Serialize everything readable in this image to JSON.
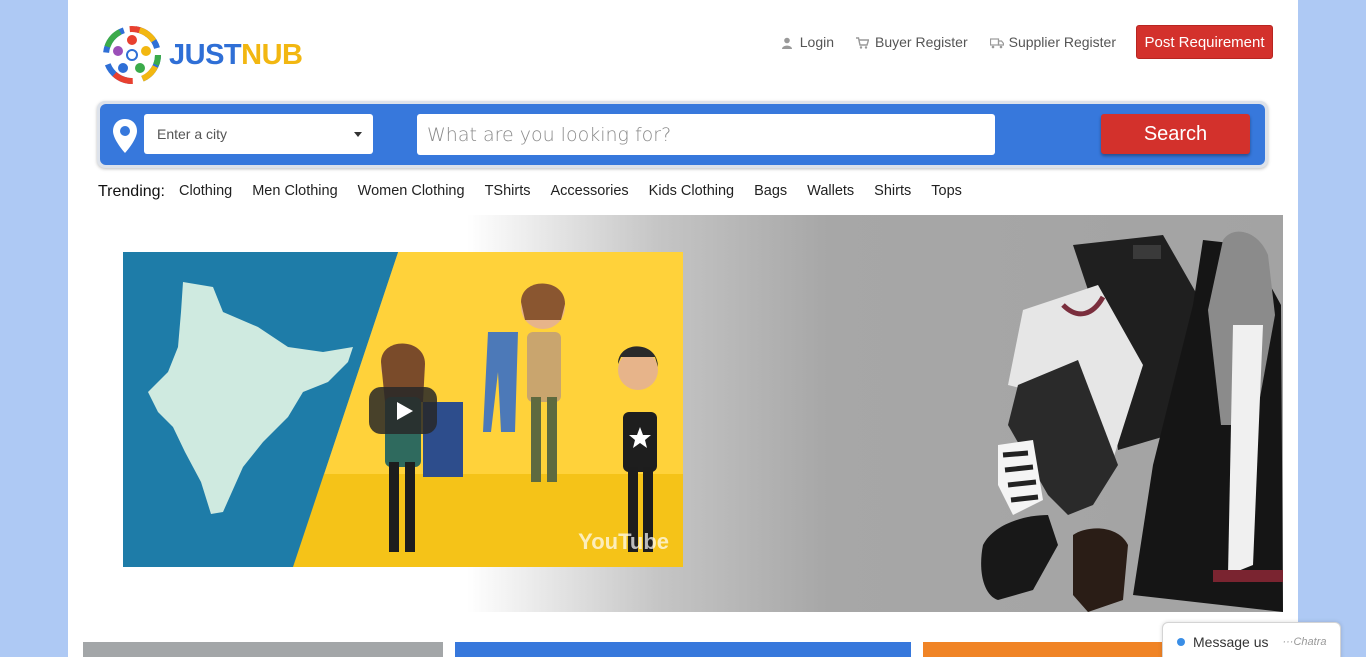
{
  "header": {
    "logo_text_part1": "JUST",
    "logo_text_part2": "NUB",
    "links": [
      {
        "label": "Login",
        "icon": "user-icon"
      },
      {
        "label": "Buyer Register",
        "icon": "cart-icon"
      },
      {
        "label": "Supplier Register",
        "icon": "truck-icon"
      }
    ],
    "post_button": "Post Requirement"
  },
  "search": {
    "city_placeholder": "Enter a city",
    "query_placeholder": "What are you looking for?",
    "button_label": "Search"
  },
  "trending": {
    "label": "Trending:",
    "items": [
      "Clothing",
      "Men Clothing",
      "Women Clothing",
      "TShirts",
      "Accessories",
      "Kids Clothing",
      "Bags",
      "Wallets",
      "Shirts",
      "Tops"
    ]
  },
  "video": {
    "watermark": "YouTube"
  },
  "chat": {
    "label": "Message us",
    "brand": "Chatra"
  },
  "colors": {
    "page_bg": "#aec9f4",
    "brand_blue": "#3778dc",
    "accent_red": "#d3312c",
    "logo_yellow": "#f2b711",
    "card_grey": "#a3a6a8",
    "card_orange": "#f08426"
  }
}
